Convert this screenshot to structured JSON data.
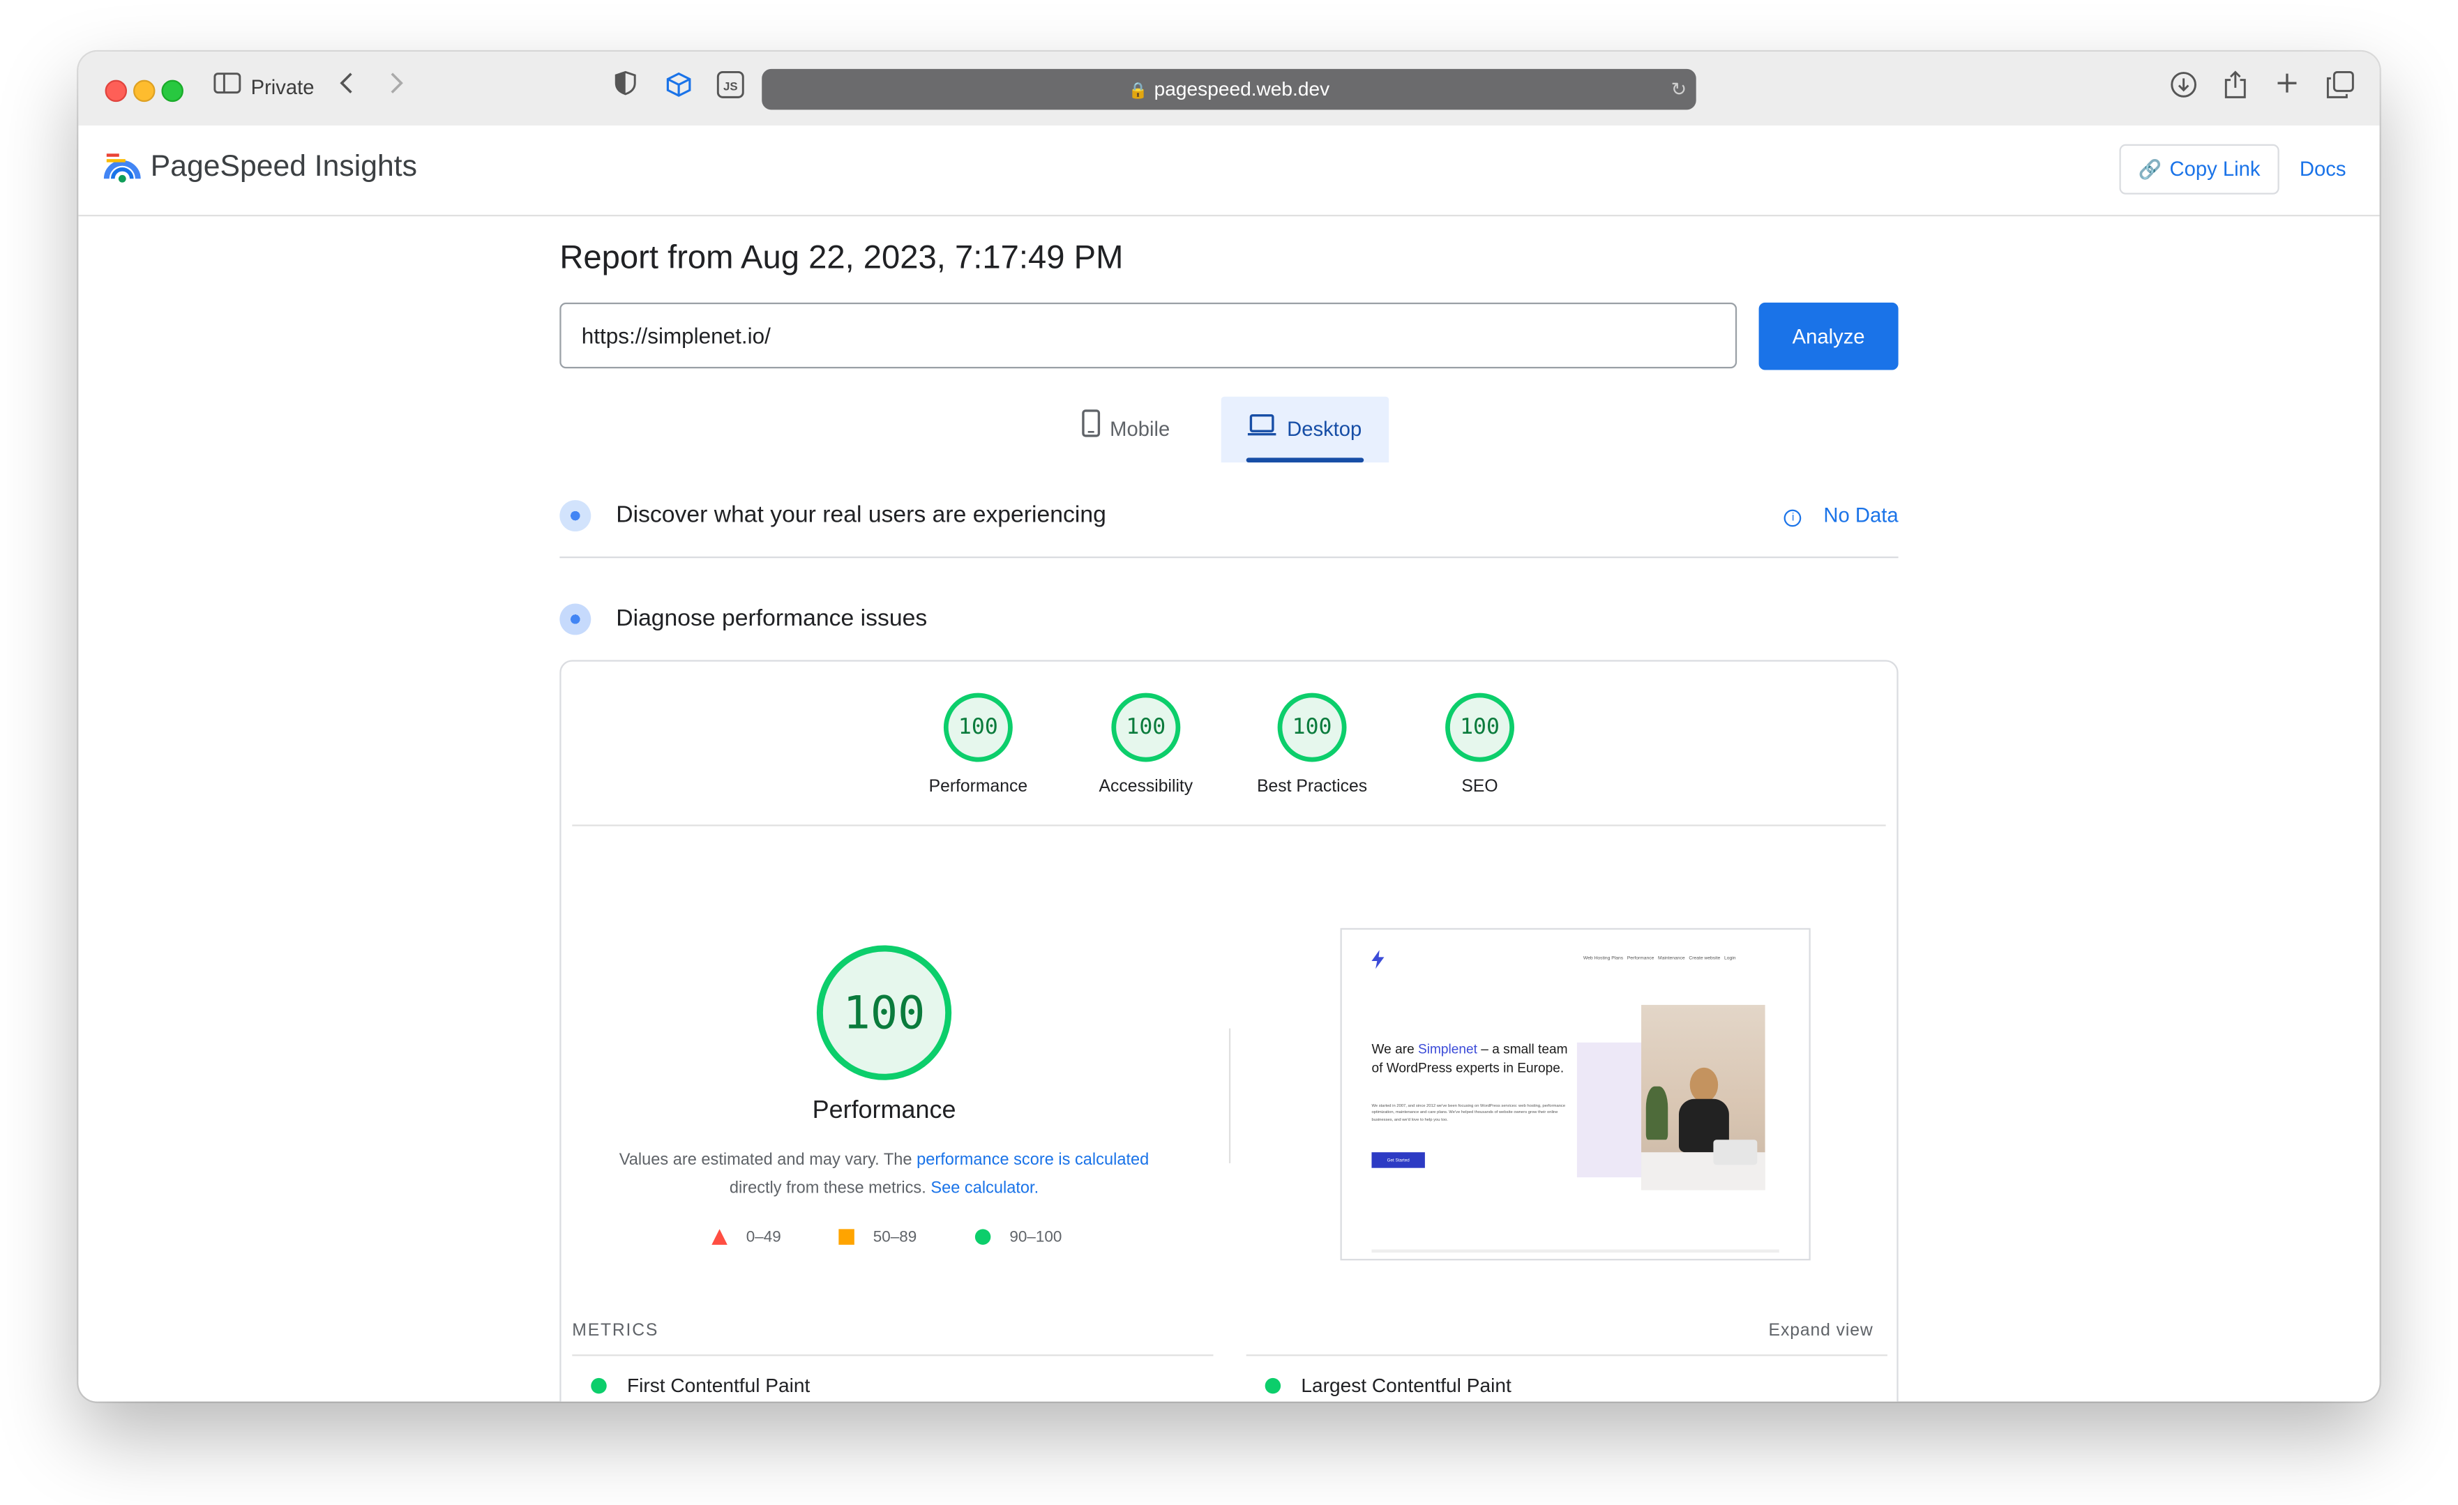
{
  "browser": {
    "private_label": "Private",
    "address": "pagespeed.web.dev",
    "toolbar_icons": [
      "sidebar-icon",
      "back-icon",
      "forward-icon",
      "shield-icon",
      "box-icon",
      "js-icon",
      "download-icon",
      "share-icon",
      "new-tab-icon",
      "tabs-overview-icon"
    ]
  },
  "header": {
    "title": "PageSpeed Insights",
    "copy_link": "Copy Link",
    "docs": "Docs"
  },
  "report": {
    "title": "Report from Aug 22, 2023, 7:17:49 PM",
    "url_value": "https://simplenet.io/",
    "analyze_label": "Analyze",
    "tabs": [
      {
        "label": "Mobile",
        "icon": "mobile-icon",
        "selected": false
      },
      {
        "label": "Desktop",
        "icon": "desktop-icon",
        "selected": true
      }
    ]
  },
  "field_data": {
    "title": "Discover what your real users are experiencing",
    "status": "No Data"
  },
  "lab": {
    "title": "Diagnose performance issues",
    "categories": [
      {
        "label": "Performance",
        "score": "100"
      },
      {
        "label": "Accessibility",
        "score": "100"
      },
      {
        "label": "Best Practices",
        "score": "100"
      },
      {
        "label": "SEO",
        "score": "100"
      }
    ],
    "main_score": "100",
    "main_label": "Performance",
    "note_prefix": "Values are estimated and may vary. The ",
    "note_link1": "performance score is calculated",
    "note_middle": "directly from these metrics. ",
    "note_link2": "See calculator.",
    "legend": [
      {
        "range": "0–49",
        "color": "#ff4e42"
      },
      {
        "range": "50–89",
        "color": "#ffa400"
      },
      {
        "range": "90–100",
        "color": "#0cce6b"
      }
    ],
    "metrics_label": "METRICS",
    "expand_label": "Expand view",
    "metrics": [
      "First Contentful Paint",
      "Largest Contentful Paint"
    ]
  },
  "screenshot": {
    "nav": [
      "Web Hosting Plans",
      "Performance",
      "Maintenance",
      "Create website",
      "Login"
    ],
    "headline_prefix": "We are ",
    "headline_brand": "Simplenet",
    "headline_rest": " – a small team of WordPress experts in Europe.",
    "body": "We started in 2007, and since 2012 we've been focusing on WordPress services: web hosting, performance optimization, maintenance and care plans. We've helped thousands of website owners grow their online businesses, and we'd love to help you too.",
    "cta": "Get Started"
  },
  "colors": {
    "accent": "#1a73e8",
    "pass": "#0cce6b",
    "average": "#ffa400",
    "fail": "#ff4e42"
  }
}
